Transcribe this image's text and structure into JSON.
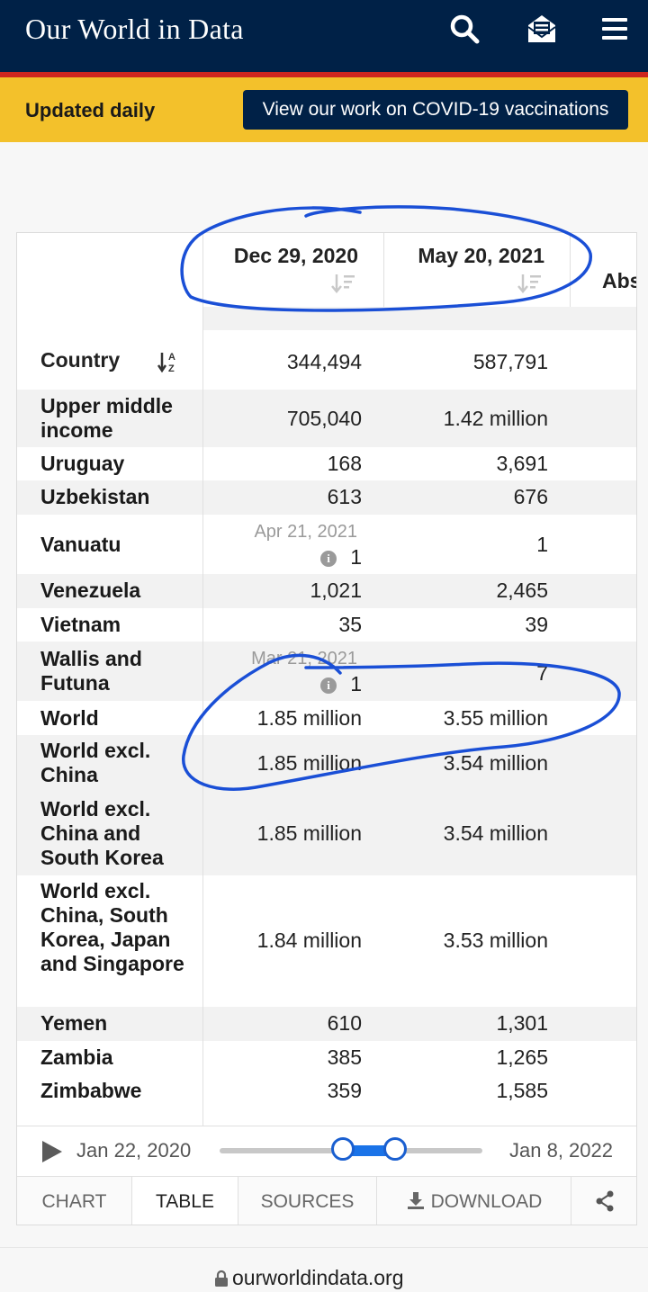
{
  "header": {
    "logo": "Our World in Data",
    "icons": [
      "search-icon",
      "subscribe-icon",
      "menu-icon"
    ]
  },
  "banner": {
    "text": "Updated daily",
    "button": "View our work on COVID-19 vaccinations"
  },
  "table": {
    "country_header": "Country",
    "columns": [
      {
        "label": "Dec 29, 2020"
      },
      {
        "label": "May 20, 2021"
      },
      {
        "label": "Abs"
      }
    ],
    "first_row": {
      "v1": "344,494",
      "v2": "587,791"
    },
    "rows": [
      {
        "country": "Upper middle income",
        "v1": "705,040",
        "v2": "1.42 million"
      },
      {
        "country": "Uruguay",
        "v1": "168",
        "v2": "3,691"
      },
      {
        "country": "Uzbekistan",
        "v1": "613",
        "v2": "676"
      },
      {
        "country": "Vanuatu",
        "v1": "1",
        "v1_note": "Apr 21, 2021",
        "v2": "1"
      },
      {
        "country": "Venezuela",
        "v1": "1,021",
        "v2": "2,465"
      },
      {
        "country": "Vietnam",
        "v1": "35",
        "v2": "39"
      },
      {
        "country": "Wallis and Futuna",
        "v1": "1",
        "v1_note": "Mar 21, 2021",
        "v2": "7"
      },
      {
        "country": "World",
        "v1": "1.85 million",
        "v2": "3.55 million"
      },
      {
        "country": "World excl. China",
        "v1": "1.85 million",
        "v2": "3.54 million"
      },
      {
        "country": "World excl. China and South Korea",
        "v1": "1.85 million",
        "v2": "3.54 million"
      },
      {
        "country": "World excl. China, South Korea, Japan and Singapore",
        "v1": "1.84 million",
        "v2": "3.53 million"
      },
      {
        "country": "Yemen",
        "v1": "610",
        "v2": "1,301"
      },
      {
        "country": "Zambia",
        "v1": "385",
        "v2": "1,265"
      },
      {
        "country": "Zimbabwe",
        "v1": "359",
        "v2": "1,585"
      }
    ]
  },
  "timeline": {
    "start": "Jan 22, 2020",
    "end": "Jan 8, 2022",
    "selected_start": "Dec 29, 2020",
    "selected_end": "May 20, 2021"
  },
  "tabs": [
    "CHART",
    "TABLE",
    "SOURCES",
    "DOWNLOAD"
  ],
  "active_tab": "TABLE",
  "url": "ourworldindata.org",
  "colors": {
    "navy": "#002147",
    "yellow": "#f3c12b",
    "red": "#ce261e",
    "annotation": "#1a4fd6"
  }
}
